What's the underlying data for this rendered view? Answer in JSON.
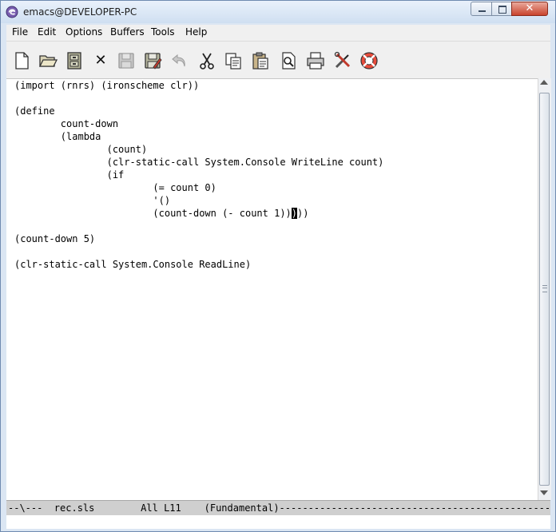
{
  "window": {
    "title": "emacs@DEVELOPER-PC",
    "controls": {
      "close_glyph": "✕"
    }
  },
  "menubar": {
    "items": [
      "File",
      "Edit",
      "Options",
      "Buffers",
      "Tools",
      "Help"
    ]
  },
  "toolbar": {
    "icons": [
      "new-file-icon",
      "open-folder-icon",
      "dired-cabinet-icon",
      "close-buffer-icon",
      "save-icon",
      "save-as-icon",
      "undo-icon",
      "cut-icon",
      "copy-icon",
      "paste-icon",
      "search-icon",
      "print-icon",
      "customize-icon",
      "help-icon"
    ],
    "close_glyph": "✕"
  },
  "editor": {
    "lines": [
      "(import (rnrs) (ironscheme clr))",
      "",
      "(define",
      "        count-down",
      "        (lambda",
      "                (count)",
      "                (clr-static-call System.Console WriteLine count)",
      "                (if",
      "                        (= count 0)",
      "                        '()",
      "                        (count-down (- count 1))",
      "",
      "(count-down 5)",
      "",
      "(clr-static-call System.Console ReadLine)"
    ],
    "cursor_char": ")",
    "after_cursor": "))"
  },
  "modeline": {
    "text": "--\\---  rec.sls        All L11    (Fundamental)--------------------------------------------------------"
  },
  "minibuffer": {
    "text": ""
  },
  "colors": {
    "titlebar": "#dbe6f3",
    "close_button": "#c9432d",
    "modeline": "#cfcfcf"
  }
}
